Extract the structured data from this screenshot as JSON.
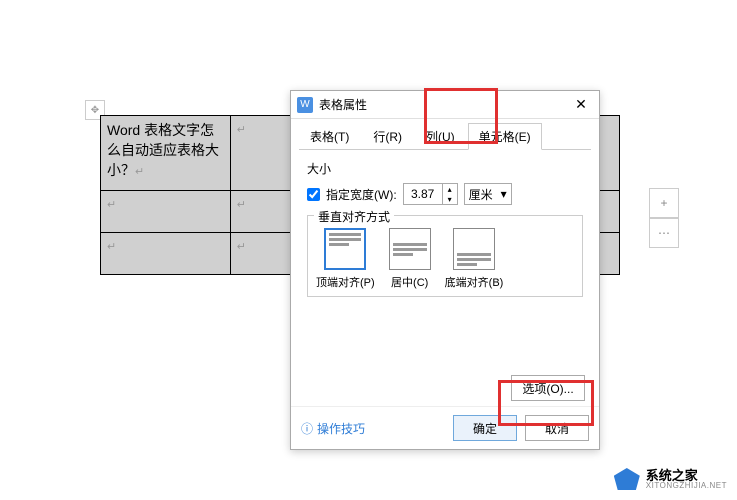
{
  "document": {
    "cell_text": "Word 表格文字怎么自动适应表格大小？",
    "cell_mark": "↵"
  },
  "dialog": {
    "title": "表格属性",
    "tabs": {
      "table": "表格(T)",
      "row": "行(R)",
      "column": "列(U)",
      "cell": "单元格(E)"
    },
    "size_label": "大小",
    "width_checkbox": "指定宽度(W):",
    "width_value": "3.87",
    "width_unit": "厘米",
    "valign_label": "垂直对齐方式",
    "align": {
      "top": "顶端对齐(P)",
      "center": "居中(C)",
      "bottom": "底端对齐(B)"
    },
    "options_btn": "选项(O)...",
    "tip_link": "操作技巧",
    "ok": "确定",
    "cancel": "取消"
  },
  "watermark": {
    "cn": "系统之家",
    "en": "XITONGZHIJIA.NET"
  }
}
